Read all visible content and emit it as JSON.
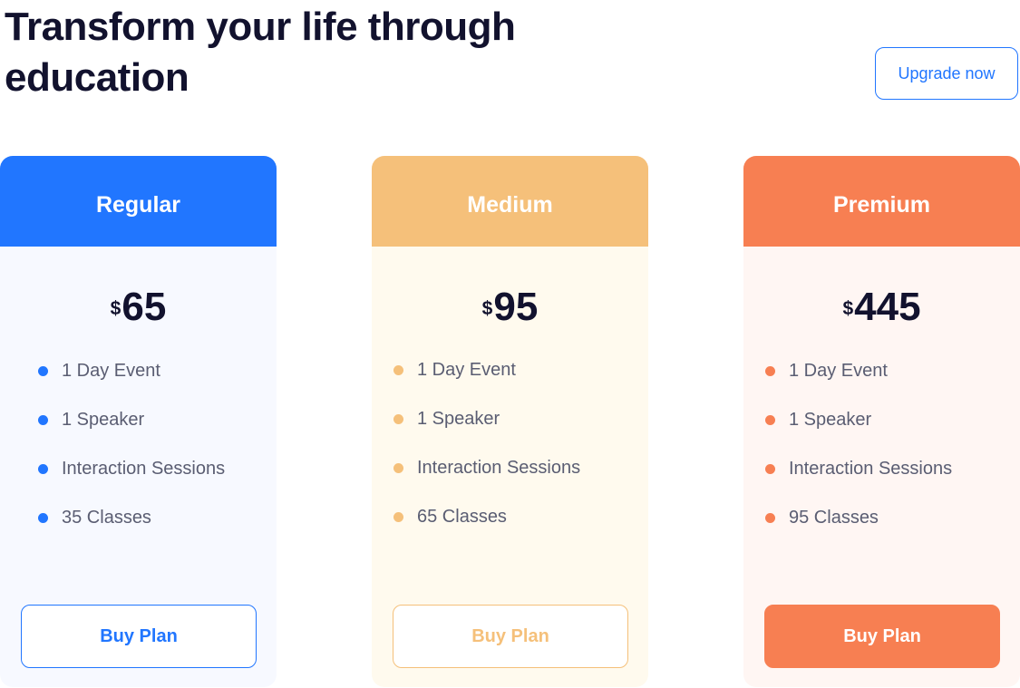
{
  "header": {
    "title": "Transform your life through education",
    "upgrade_label": "Upgrade now"
  },
  "colors": {
    "heading": "#12122e",
    "body_text": "#5a5d72",
    "accent_blue": "#2176ff"
  },
  "plans": [
    {
      "name": "Regular",
      "currency": "$",
      "price": "65",
      "features": [
        "1 Day Event",
        "1 Speaker",
        "Interaction Sessions",
        "35 Classes"
      ],
      "button_label": "Buy Plan",
      "button_style": "outline",
      "accent": "#2176ff",
      "body_bg": "#f7f9ff"
    },
    {
      "name": "Medium",
      "currency": "$",
      "price": "95",
      "features": [
        "1 Day Event",
        "1 Speaker",
        "Interaction Sessions",
        "65 Classes"
      ],
      "button_label": "Buy Plan",
      "button_style": "outline",
      "accent": "#f5c07a",
      "body_bg": "#fffaee"
    },
    {
      "name": "Premium",
      "currency": "$",
      "price": "445",
      "features": [
        "1 Day Event",
        "1 Speaker",
        "Interaction Sessions",
        "95 Classes"
      ],
      "button_label": "Buy Plan",
      "button_style": "filled",
      "accent": "#f77f52",
      "body_bg": "#fff6f3"
    }
  ]
}
